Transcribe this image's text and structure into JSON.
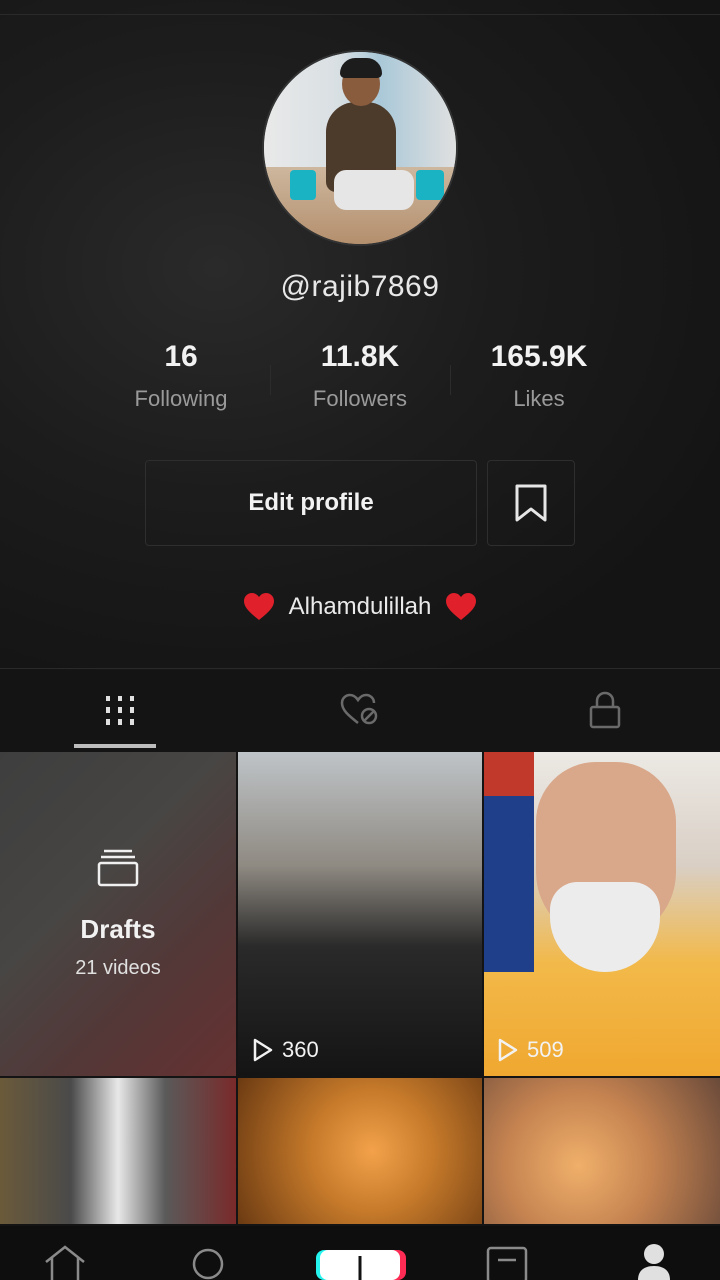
{
  "profile": {
    "username": "@rajib7869",
    "bio_text": "Alhamdulillah"
  },
  "stats": [
    {
      "value": "16",
      "label": "Following"
    },
    {
      "value": "11.8K",
      "label": "Followers"
    },
    {
      "value": "165.9K",
      "label": "Likes"
    }
  ],
  "buttons": {
    "edit_profile": "Edit profile"
  },
  "tabs": [
    {
      "icon": "grid-icon",
      "active": true
    },
    {
      "icon": "liked-heart-icon",
      "active": false
    },
    {
      "icon": "lock-icon",
      "active": false
    }
  ],
  "drafts": {
    "title": "Drafts",
    "count": "21 videos"
  },
  "videos": [
    {
      "views": "360"
    },
    {
      "views": "509"
    }
  ],
  "bottom_nav": [
    "home-icon",
    "discover-icon",
    "create-icon",
    "inbox-icon",
    "profile-icon"
  ],
  "colors": {
    "background": "#141414",
    "heart": "#e0202a",
    "create_left": "#25f4ee",
    "create_right": "#fe2c55"
  }
}
